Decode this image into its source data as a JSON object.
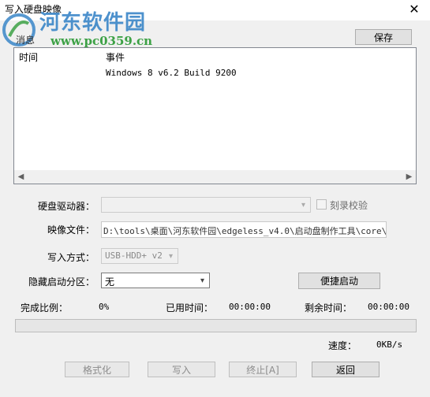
{
  "window": {
    "title": "写入硬盘映像",
    "close_glyph": "✕"
  },
  "watermark": {
    "site_name": "河东软件园",
    "url": "www.pc0359.cn"
  },
  "message_group": {
    "label": "消息",
    "save_button": "保存",
    "columns": [
      "时间",
      "事件"
    ],
    "rows": [
      {
        "time": "",
        "event": "Windows 8 v6.2 Build 9200"
      }
    ]
  },
  "form": {
    "drive_label": "硬盘驱动器：",
    "drive_value": "",
    "verify_label": "刻录校验",
    "verify_checked": false,
    "image_label": "映像文件：",
    "image_value": "D:\\tools\\桌面\\河东软件园\\edgeless_v4.0\\启动盘制作工具\\core\\",
    "method_label": "写入方式：",
    "method_value": "USB-HDD+ v2",
    "hidden_label": "隐藏启动分区：",
    "hidden_value": "无",
    "quick_boot_button": "便捷启动"
  },
  "status": {
    "ratio_label": "完成比例：",
    "ratio_value": "0%",
    "elapsed_label": "已用时间：",
    "elapsed_value": "00:00:00",
    "remaining_label": "剩余时间：",
    "remaining_value": "00:00:00",
    "progress": 0,
    "speed_label": "速度：",
    "speed_value": "0KB/s"
  },
  "buttons": {
    "format": "格式化",
    "write": "写入",
    "abort": "终止[A]",
    "back": "返回"
  },
  "colors": {
    "watermark_blue": "#3a86c8",
    "watermark_green": "#3ca145",
    "progress_fill": "#06b025"
  }
}
